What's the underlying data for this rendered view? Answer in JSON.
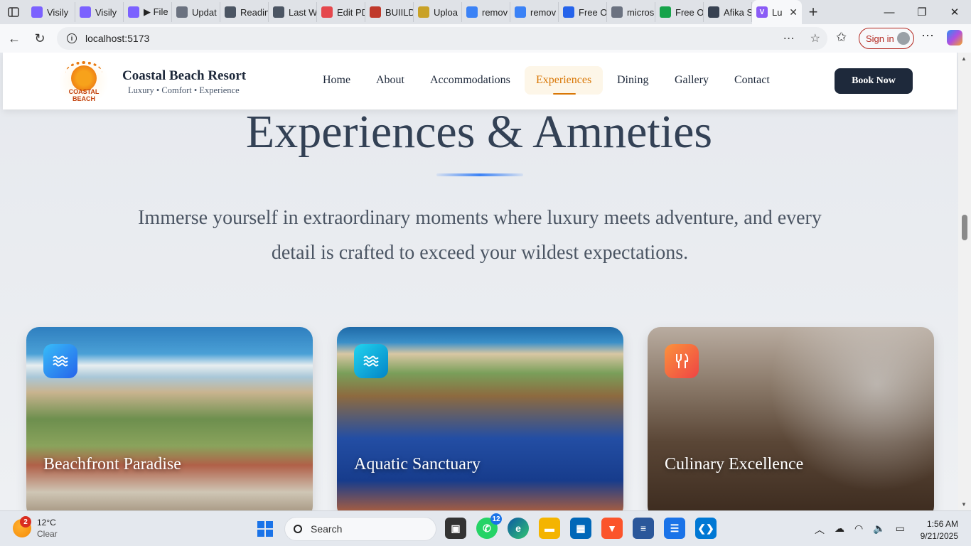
{
  "browser": {
    "tabs": [
      {
        "label": "Visily",
        "color": "#7b61ff"
      },
      {
        "label": "Visily",
        "color": "#7b61ff"
      },
      {
        "label": "▶ File",
        "color": "#7b61ff"
      },
      {
        "label": "Updat",
        "color": "#6b7280"
      },
      {
        "label": "Readin",
        "color": "#4b5563"
      },
      {
        "label": "Last W",
        "color": "#4b5563"
      },
      {
        "label": "Edit PD",
        "color": "#e5484d"
      },
      {
        "label": "BUIILD",
        "color": "#c0392b"
      },
      {
        "label": "Uploa",
        "color": "#c9a227"
      },
      {
        "label": "remov",
        "color": "#3b82f6"
      },
      {
        "label": "remov",
        "color": "#3b82f6"
      },
      {
        "label": "Free O",
        "color": "#2563eb"
      },
      {
        "label": "micros",
        "color": "#6b7280"
      },
      {
        "label": "Free O",
        "color": "#16a34a"
      },
      {
        "label": "Afika S",
        "color": "#374151"
      }
    ],
    "active_tab": {
      "label": "Lu",
      "color": "#8b5cf6"
    },
    "url": "localhost:5173",
    "signin_label": "Sign in"
  },
  "site": {
    "brand": "Coastal Beach Resort",
    "tagline": "Luxury • Comfort • Experience",
    "logo_text": "COASTAL BEACH",
    "nav": [
      "Home",
      "About",
      "Accommodations",
      "Experiences",
      "Dining",
      "Gallery",
      "Contact"
    ],
    "active_nav": "Experiences",
    "book_label": "Book Now",
    "hero_title": "Experiences & Amneties",
    "hero_sub": "Immerse yourself in extraordinary moments where luxury meets adventure, and every detail is crafted to exceed your wildest expectations.",
    "cards": [
      {
        "title": "Beachfront Paradise",
        "icon": "waves-icon",
        "badge_color": "#0ea5e9"
      },
      {
        "title": "Aquatic Sanctuary",
        "icon": "waves-icon",
        "badge_color": "#0ea5e9"
      },
      {
        "title": "Culinary Excellence",
        "icon": "utensils-icon",
        "badge_color": "#f97316"
      }
    ]
  },
  "taskbar": {
    "weather_temp": "12°C",
    "weather_cond": "Clear",
    "weather_badge": "2",
    "search_label": "Search",
    "whatsapp_count": "12",
    "time": "1:56 AM",
    "date": "9/21/2025"
  }
}
